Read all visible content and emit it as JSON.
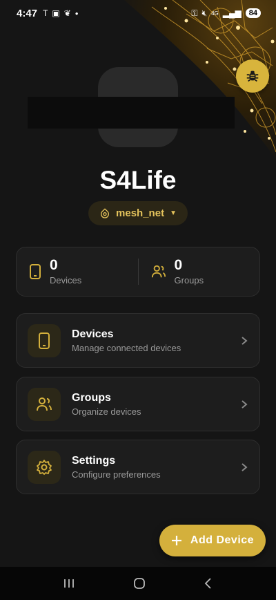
{
  "status_bar": {
    "time": "4:47",
    "network": "4G",
    "battery": "84",
    "icons": [
      "tesla-icon",
      "screen-record-icon",
      "bird-icon",
      "dot-icon",
      "key-icon",
      "mute-icon",
      "signal-icon",
      "battery-icon"
    ]
  },
  "header": {
    "app_title": "S4Life",
    "network_name": "mesh_net",
    "debug_icon": "bug-icon"
  },
  "stats": [
    {
      "value": "0",
      "label": "Devices",
      "icon": "phone-icon"
    },
    {
      "value": "0",
      "label": "Groups",
      "icon": "users-icon"
    }
  ],
  "menu": [
    {
      "title": "Devices",
      "subtitle": "Manage connected devices",
      "icon": "phone-icon"
    },
    {
      "title": "Groups",
      "subtitle": "Organize devices",
      "icon": "users-icon"
    },
    {
      "title": "Settings",
      "subtitle": "Configure preferences",
      "icon": "gear-icon"
    }
  ],
  "fab": {
    "label": "Add Device",
    "icon": "plus-icon"
  },
  "nav": {
    "icons": [
      "recents-icon",
      "home-icon",
      "back-icon"
    ]
  },
  "colors": {
    "accent": "#d4b03c",
    "background": "#151515",
    "card": "#1d1d1d"
  }
}
